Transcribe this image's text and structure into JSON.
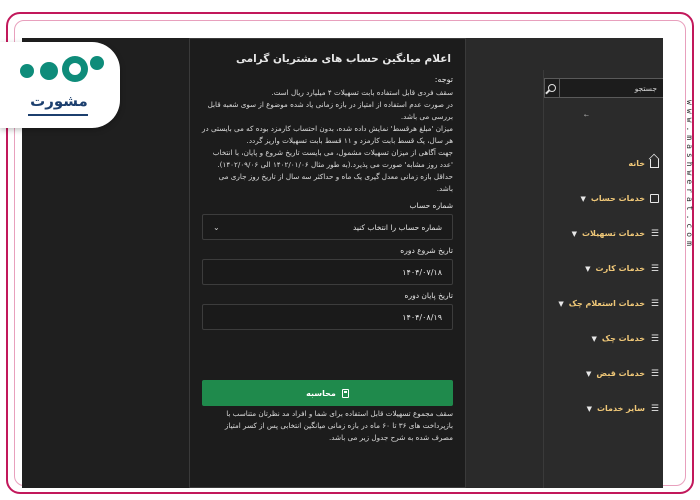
{
  "watermark": "www.mashwerat.com",
  "logo": {
    "text": "مشورت"
  },
  "panel": {
    "title": "اعلام میانگین حساب های مشتریان گرامی",
    "note_label": "توجه:",
    "notes": [
      "سقف فردی قابل استفاده بابت تسهیلات ۴ میلیارد ریال است.",
      "در صورت عدم استفاده از امتیاز در بازه زمانی یاد شده موضوع از سوی شعبه قابل بررسی می باشد.",
      "میزان 'مبلغ هرقسط' نمایش داده شده، بدون احتساب کارمزد بوده که می بایستی در هر سال، یک قسط بابت کارمزد و ۱۱ قسط بابت تسهیلات واریز گردد.",
      "جهت آگاهی از میزان تسهیلات مشمول، می بایست تاریخ شروع و پایان، با انتخاب 'عدد روز مشابه' صورت می پذیرد.(به طور مثال ۱۴۰۲/۰۱/۰۶ الی ۱۴۰۲/۰۹/۰۶).",
      "حداقل بازه زمانی معدل گیری یک ماه و حداکثر سه سال از تاریخ روز جاری می باشد."
    ],
    "account_label": "شماره حساب",
    "account_select": "شماره حساب را انتخاب کنید",
    "start_label": "تاریخ شروع دوره",
    "start_value": "۱۴۰۴/۰۷/۱۸",
    "end_label": "تاریخ پایان دوره",
    "end_value": "۱۴۰۴/۰۸/۱۹",
    "calc_button": "محاسبه",
    "footnote": "سقف مجموع تسهیلات قابل استفاده برای شما و افراد مد نظرتان متناسب با بازپرداخت های ۳۶ تا ۶۰ ماه در بازه زمانی میانگین انتخابی پس از کسر امتیاز مصرف شده به شرح جدول زیر می باشد."
  },
  "sidebar": {
    "search_placeholder": "جستجو",
    "items": [
      {
        "label": "خانه",
        "icon": "home-icon",
        "has_chevron": false
      },
      {
        "label": "خدمات حساب",
        "icon": "folder-icon",
        "has_chevron": true
      },
      {
        "label": "خدمات تسهیلات",
        "icon": "list-check-icon",
        "has_chevron": true
      },
      {
        "label": "خدمات کارت",
        "icon": "list-check-icon",
        "has_chevron": true
      },
      {
        "label": "خدمات استعلام چک",
        "icon": "list-check-icon",
        "has_chevron": true
      },
      {
        "label": "خدمات چک",
        "icon": "list-check-icon",
        "has_chevron": true
      },
      {
        "label": "خدمات قبض",
        "icon": "list-check-icon",
        "has_chevron": true
      },
      {
        "label": "سایر خدمات",
        "icon": "list-check-icon",
        "has_chevron": true
      }
    ]
  },
  "colors": {
    "accent_green": "#1f8a4c",
    "menu_text": "#f0c878",
    "frame": "#c2185b",
    "logo": "#0e8c7a"
  }
}
